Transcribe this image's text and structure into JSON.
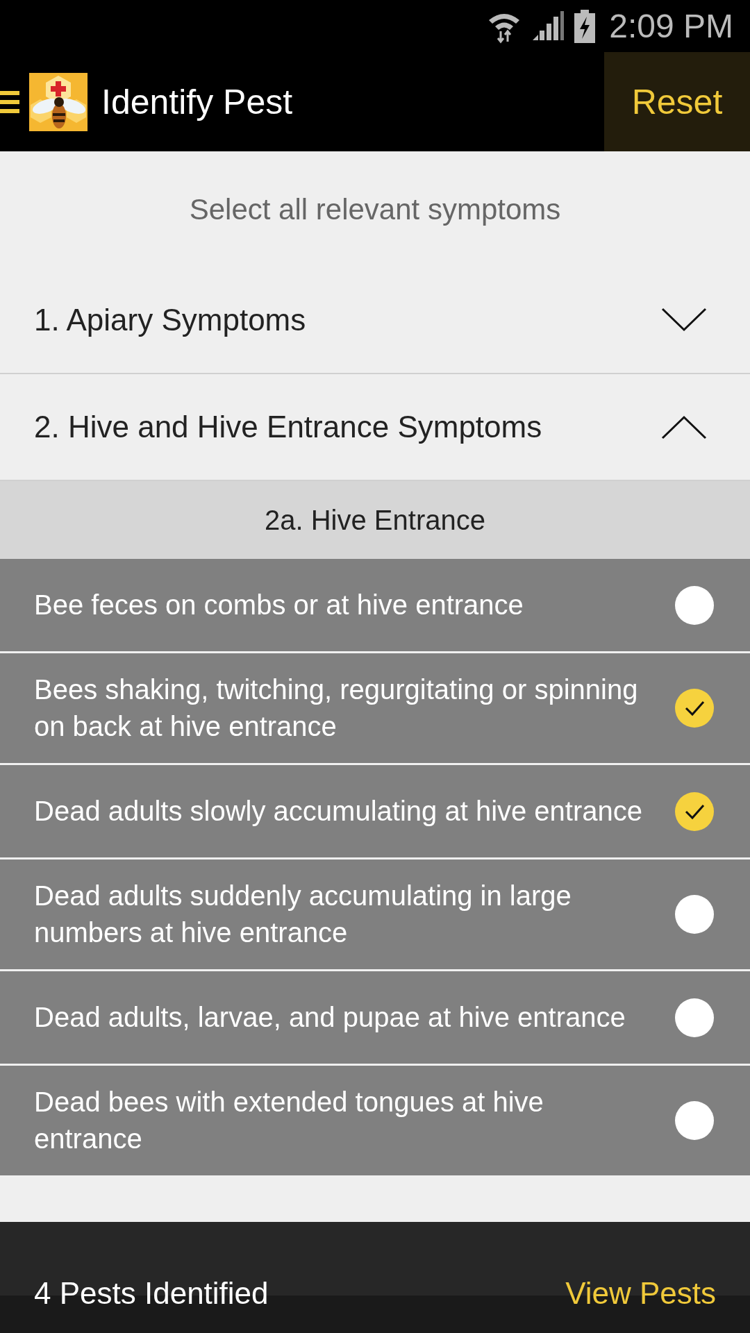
{
  "status_bar": {
    "time": "2:09 PM"
  },
  "app_bar": {
    "title": "Identify Pest",
    "action": "Reset"
  },
  "instruction": "Select all relevant symptoms",
  "sections": [
    {
      "title": "1. Apiary Symptoms",
      "expanded": false
    },
    {
      "title": "2. Hive and Hive Entrance Symptoms",
      "expanded": true,
      "subsections": [
        {
          "title": "2a. Hive Entrance",
          "symptoms": [
            {
              "text": "Bee feces on combs or at hive entrance",
              "checked": false
            },
            {
              "text": "Bees shaking, twitching, regurgitating or spinning on back at hive entrance",
              "checked": true
            },
            {
              "text": "Dead adults slowly accumulating at hive entrance",
              "checked": true
            },
            {
              "text": "Dead adults suddenly accumulating in large numbers at hive entrance",
              "checked": false
            },
            {
              "text": "Dead adults, larvae, and pupae at hive entrance",
              "checked": false
            },
            {
              "text": "Dead bees with extended tongues at hive entrance",
              "checked": false
            }
          ]
        }
      ]
    }
  ],
  "footer": {
    "count": "4 Pests Identified",
    "action": "View Pests"
  }
}
